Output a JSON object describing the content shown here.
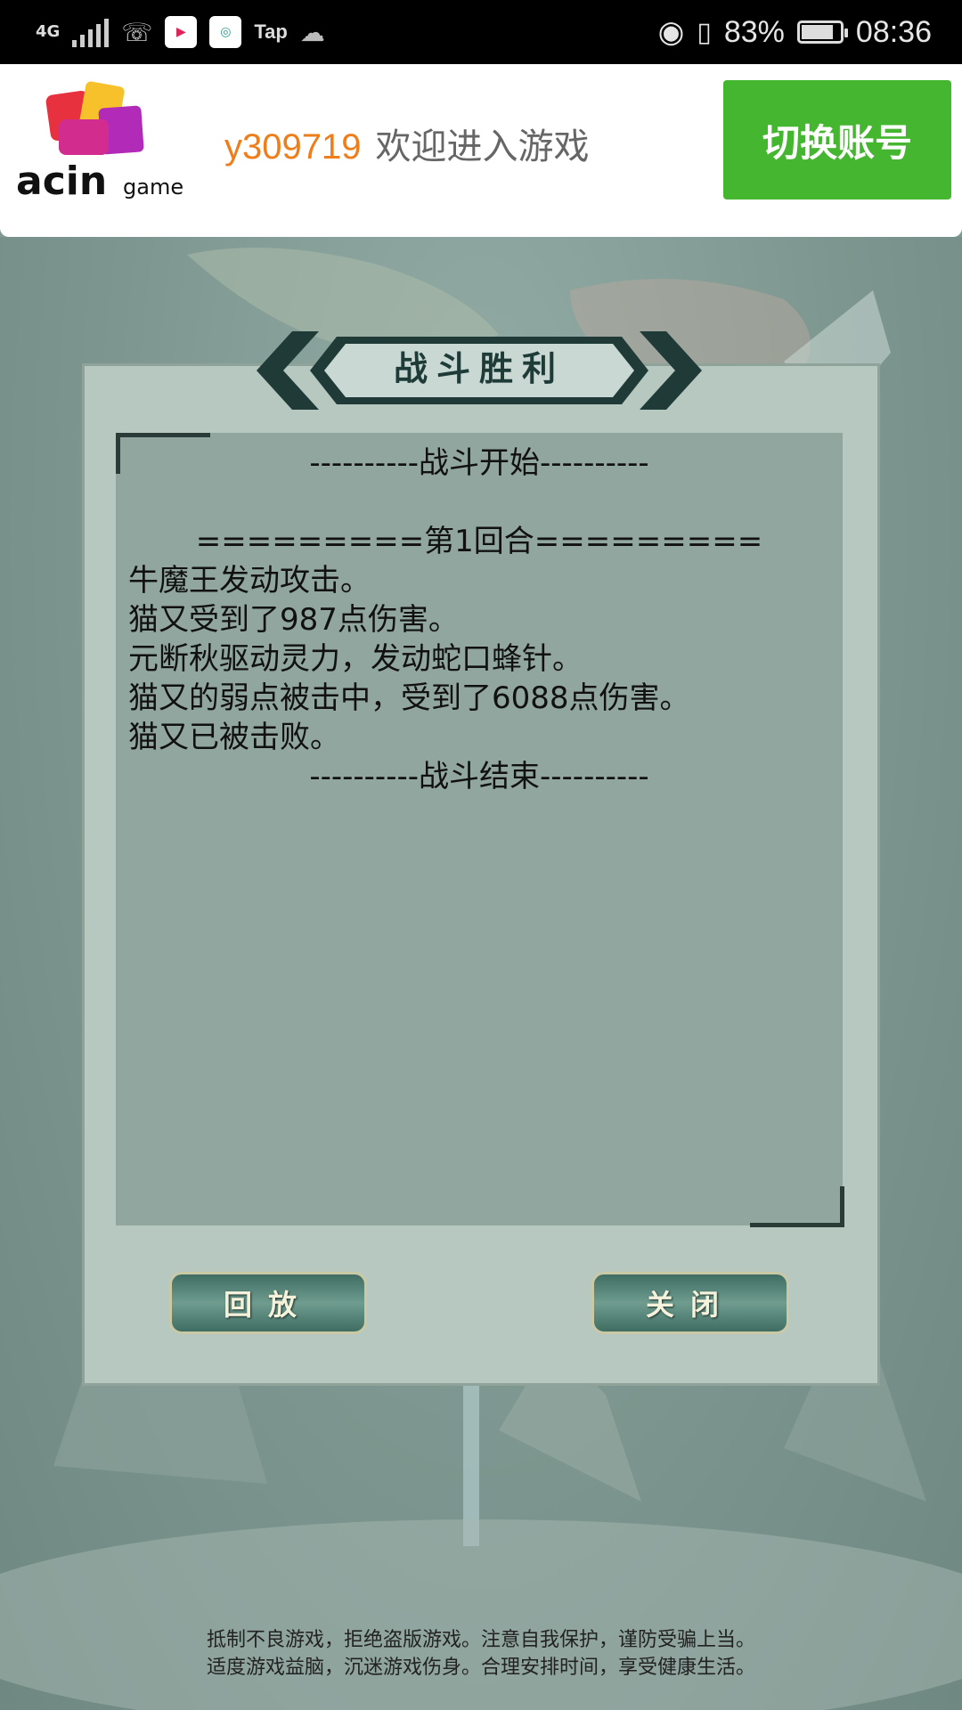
{
  "status_bar": {
    "network": "4G",
    "tap_label": "Tap",
    "battery_level": 0.83,
    "battery_percent": "83%",
    "time": "08:36"
  },
  "header": {
    "logo_text": "acingame",
    "username": "y309719",
    "welcome": "欢迎进入游戏",
    "switch_account": "切换账号"
  },
  "dialog": {
    "title": "战斗胜利",
    "log": {
      "battle_start": "----------战斗开始----------",
      "round_header": "=========第1回合=========",
      "lines": [
        "牛魔王发动攻击。",
        "猫又受到了987点伤害。",
        "元断秋驱动灵力，发动蛇口蜂针。",
        "猫又的弱点被击中，受到了6088点伤害。",
        "猫又已被击败。"
      ],
      "battle_end": "----------战斗结束----------"
    },
    "replay_button": "回放",
    "close_button": "关闭"
  },
  "footer": {
    "line1": "抵制不良游戏，拒绝盗版游戏。注意自我保护，谨防受骗上当。",
    "line2": "适度游戏益脑，沉迷游戏伤身。合理安排时间，享受健康生活。"
  },
  "colors": {
    "accent_green": "#45b62f",
    "username_orange": "#ef7d1a",
    "panel_bg": "#b7c8c0",
    "log_bg": "#91a69e"
  }
}
